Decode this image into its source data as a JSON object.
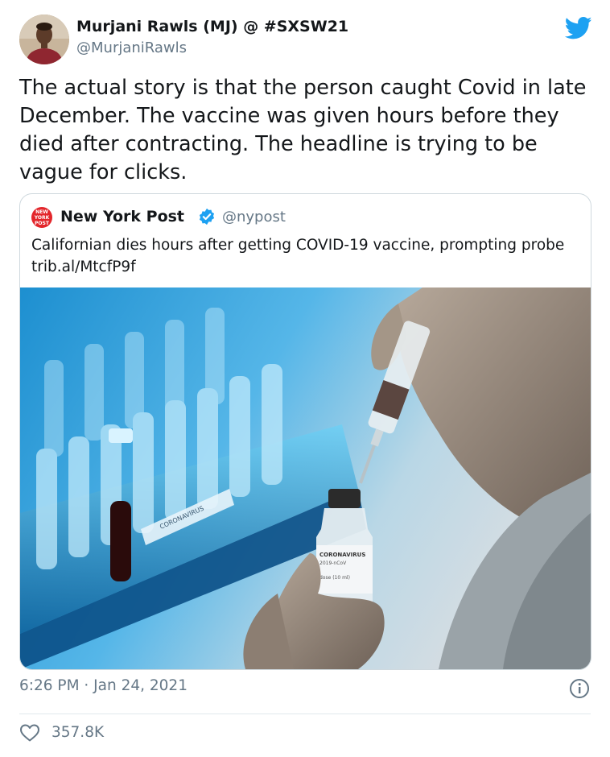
{
  "author": {
    "name": "Murjani Rawls (MJ) @ #SXSW21",
    "handle": "@MurjaniRawls",
    "avatar_icon": "user-avatar-photo"
  },
  "brand_icon": "twitter-bird-icon",
  "brand_color": "#1da1f2",
  "tweet": {
    "text": "The actual story is that the person caught Covid in late December. The vaccine was given hours before they died after contracting. The headline is trying to be vague for clicks."
  },
  "quoted_tweet": {
    "logo_text": "NEW YORK POST",
    "name": "New York Post",
    "verified_icon": "verified-badge-icon",
    "handle": "@nypost",
    "text": "Californian dies hours after getting COVID-19 vaccine, prompting probe trib.al/MtcfP9f",
    "image": {
      "description_icon": "vaccine-photo",
      "vial_label": "CORONAVIRUS",
      "vial_sublabel": "2019-nCoV",
      "vial_dose": "dose (10 ml)",
      "tray_label": "CORONAVIRUS"
    }
  },
  "timestamp": "6:26 PM · Jan 24, 2021",
  "info_icon": "info-icon",
  "likes": {
    "icon": "heart-icon",
    "count": "357.8K"
  }
}
